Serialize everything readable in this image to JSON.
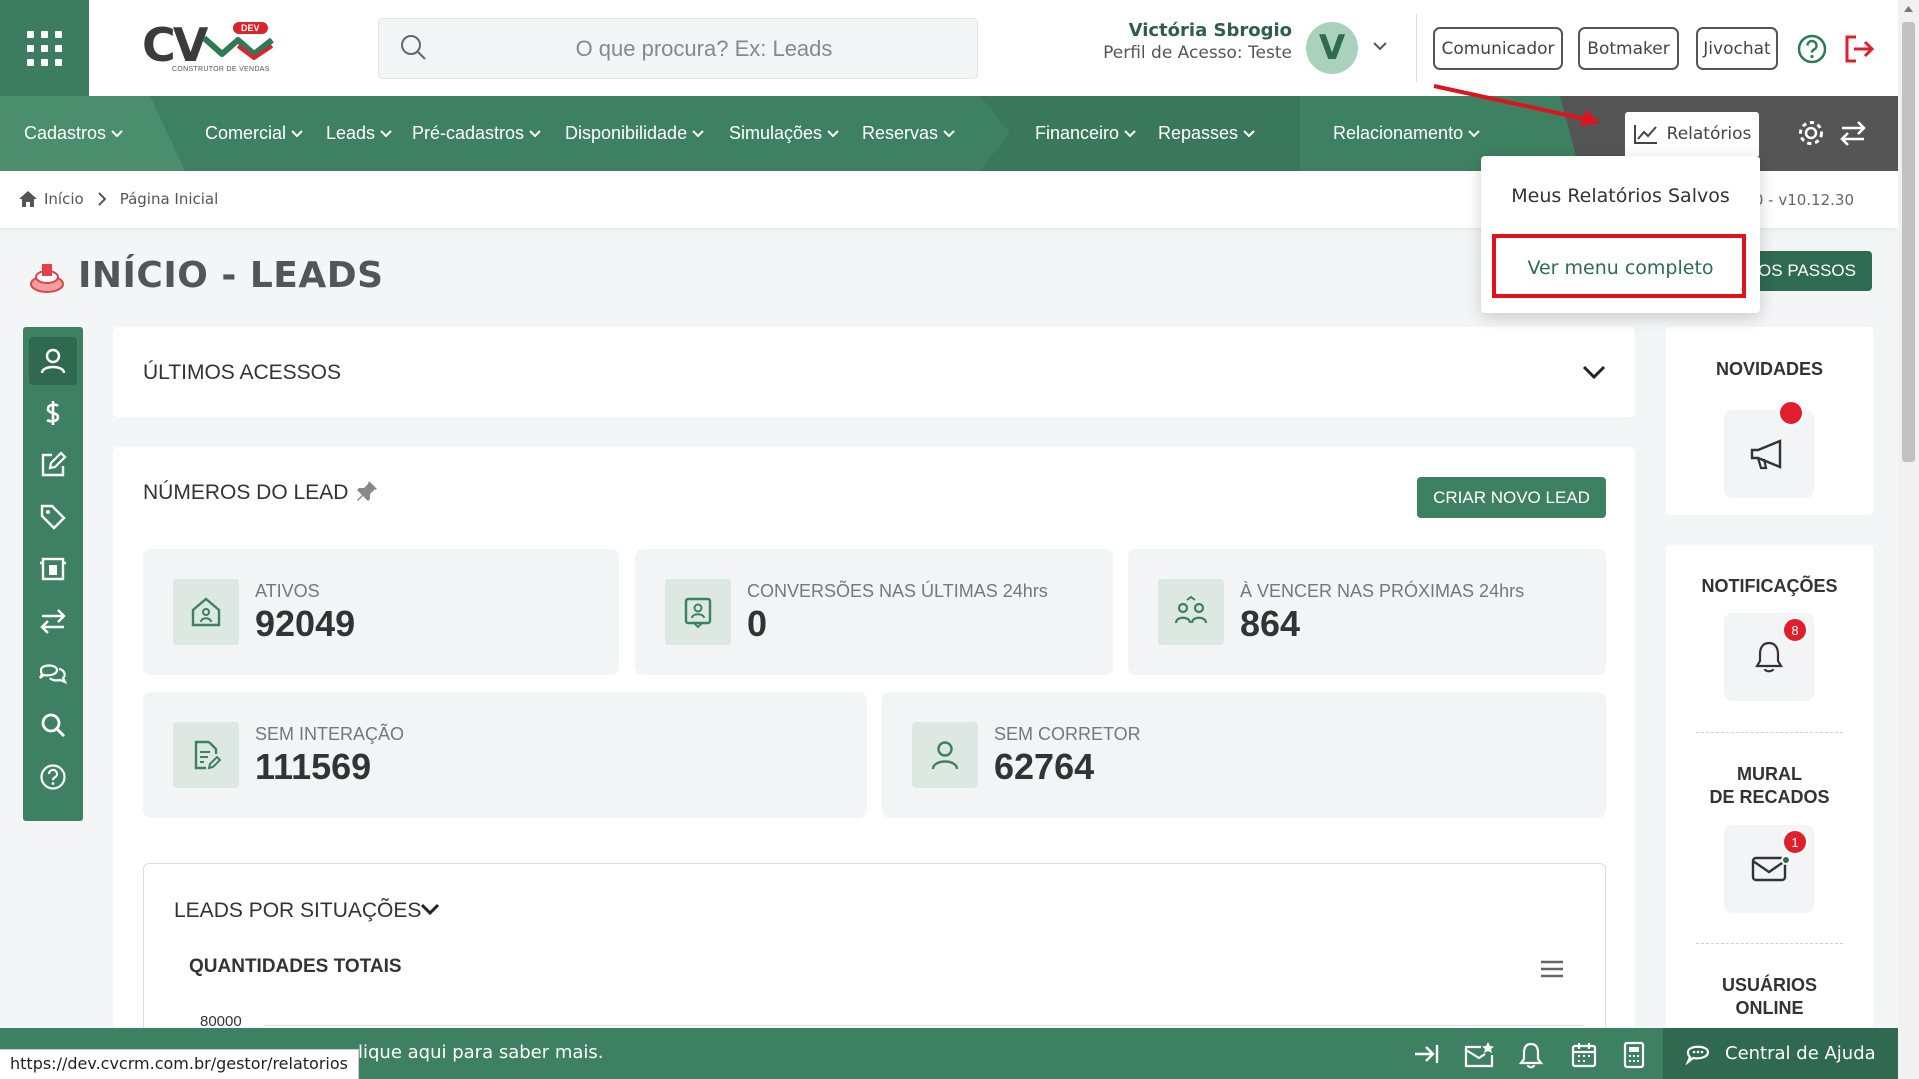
{
  "header": {
    "logo": {
      "text": "CV",
      "badge": "DEV",
      "tagline": "CONSTRUTOR DE VENDAS"
    },
    "search_placeholder": "O que procura? Ex: Leads",
    "user": {
      "name": "Victória Sbrogio",
      "profile": "Perfil de Acesso: Teste",
      "initial": "V"
    },
    "buttons": [
      "Comunicador",
      "Botmaker",
      "Jivochat"
    ]
  },
  "nav": {
    "items": [
      "Cadastros",
      "Comercial",
      "Leads",
      "Pré-cadastros",
      "Disponibilidade",
      "Simulações",
      "Reservas",
      "Financeiro",
      "Repasses",
      "Relacionamento"
    ],
    "relatorios": "Relatórios"
  },
  "dropdown": {
    "items": [
      "Meus Relatórios Salvos",
      "Ver menu completo"
    ]
  },
  "breadcrumb": {
    "home": "Início",
    "current": "Página Inicial",
    "version": "n50 - v10.12.30"
  },
  "page": {
    "title": "INÍCIO - LEADS",
    "passos": "OS PASSOS"
  },
  "ultimos": {
    "title": "ÚLTIMOS ACESSOS"
  },
  "numeros": {
    "title": "NÚMEROS DO LEAD",
    "criar": "CRIAR NOVO LEAD",
    "stats": [
      {
        "label": "ATIVOS",
        "value": "92049"
      },
      {
        "label": "CONVERSÕES NAS ÚLTIMAS 24hrs",
        "value": "0"
      },
      {
        "label": "À VENCER NAS PRÓXIMAS 24hrs",
        "value": "864"
      },
      {
        "label": "SEM INTERAÇÃO",
        "value": "111569"
      },
      {
        "label": "SEM CORRETOR",
        "value": "62764"
      }
    ]
  },
  "situacoes": {
    "title": "LEADS POR SITUAÇÕES",
    "subtitle": "QUANTIDADES TOTAIS",
    "y_tick": "80000"
  },
  "right": {
    "novidades": "NOVIDADES",
    "notificacoes": "NOTIFICAÇÕES",
    "notif_count": "8",
    "mural": "MURAL\nDE RECADOS",
    "mural_l1": "MURAL",
    "mural_l2": "DE RECADOS",
    "mural_count": "1",
    "online_l1": "USUÁRIOS",
    "online_l2": "ONLINE"
  },
  "footer": {
    "message": "lique aqui para saber mais.",
    "help": "Central de Ajuda",
    "status_url": "https://dev.cvcrm.com.br/gestor/relatorios"
  },
  "colors": {
    "primary": "#3e8062",
    "primary_dark": "#2f6a50",
    "alert": "#e11f2c"
  }
}
